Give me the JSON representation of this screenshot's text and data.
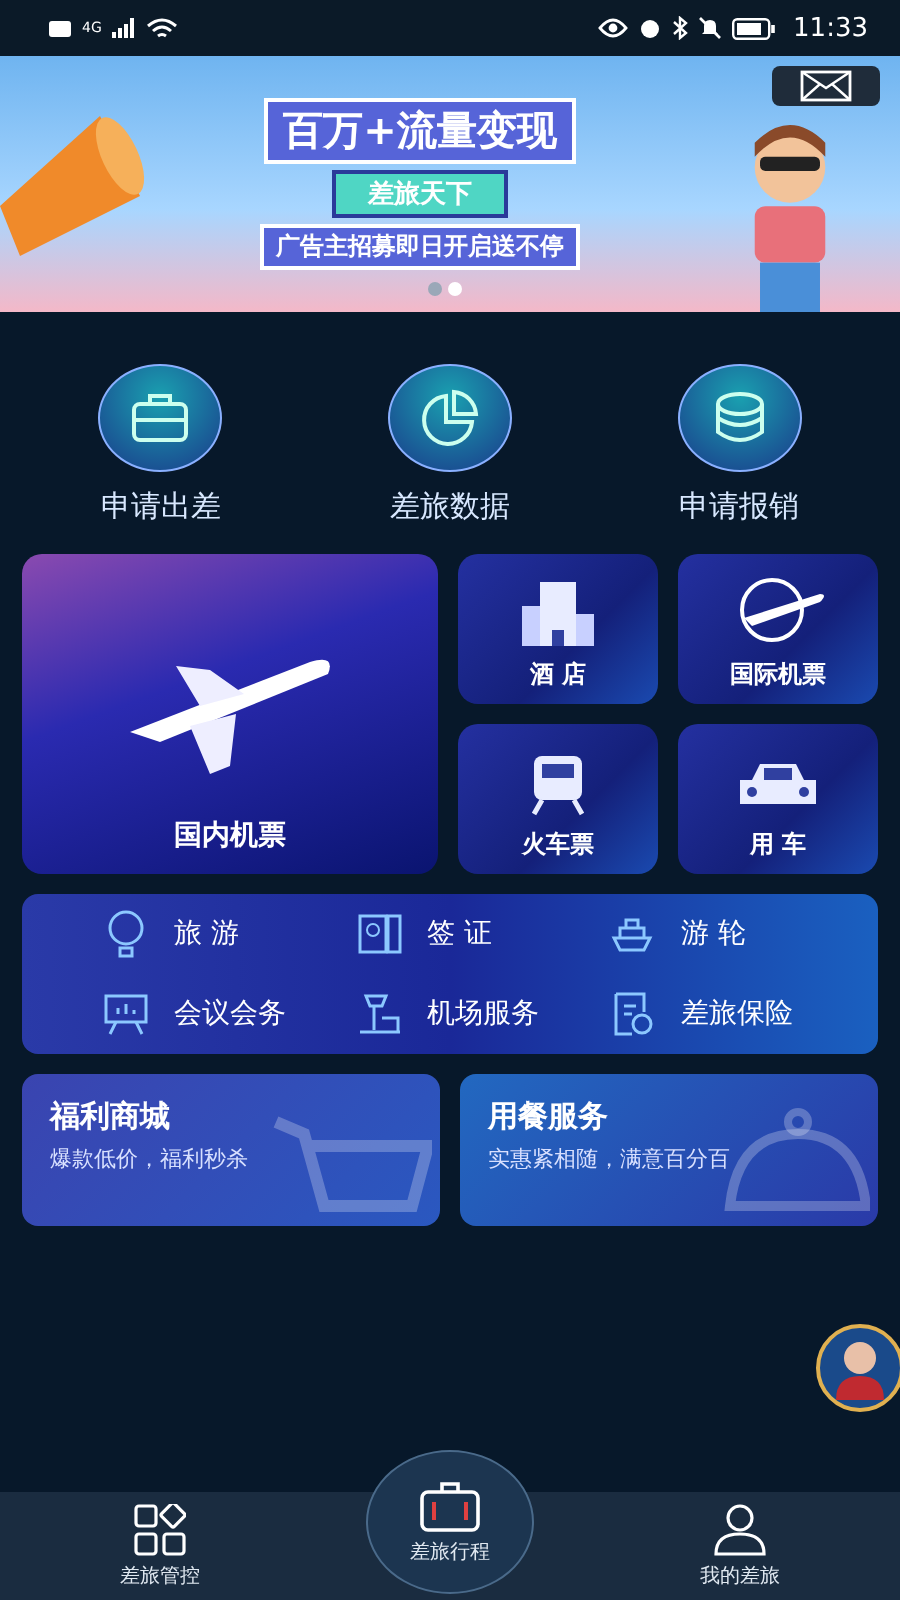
{
  "status_bar": {
    "network": "4G",
    "time": "11:33"
  },
  "banner": {
    "headline": "百万+流量变现",
    "tag": "差旅天下",
    "subline": "广告主招募即日开启送不停",
    "dots": [
      {
        "selected": false
      },
      {
        "selected": true
      }
    ]
  },
  "quick_actions": [
    {
      "label": "申请出差",
      "kind": "briefcase"
    },
    {
      "label": "差旅数据",
      "kind": "pie"
    },
    {
      "label": "申请报销",
      "kind": "coins"
    }
  ],
  "main_tile": {
    "label": "国内机票"
  },
  "small_tiles": [
    {
      "label": "酒 店",
      "kind": "hotel"
    },
    {
      "label": "国际机票",
      "kind": "globe"
    },
    {
      "label": "火车票",
      "kind": "train"
    },
    {
      "label": "用 车",
      "kind": "car"
    }
  ],
  "services": [
    {
      "label": "旅 游",
      "kind": "balloon"
    },
    {
      "label": "签 证",
      "kind": "passport"
    },
    {
      "label": "游 轮",
      "kind": "ship"
    },
    {
      "label": "会议会务",
      "kind": "board"
    },
    {
      "label": "机场服务",
      "kind": "tower"
    },
    {
      "label": "差旅保险",
      "kind": "doc"
    }
  ],
  "promos": [
    {
      "title": "福利商城",
      "subtitle": "爆款低价，福利秒杀",
      "kind": "cart"
    },
    {
      "title": "用餐服务",
      "subtitle": "实惠紧相随，满意百分百",
      "kind": "cloche"
    }
  ],
  "bottom_nav": [
    {
      "label": "差旅管控",
      "kind": "grid"
    },
    {
      "label": "差旅行程",
      "kind": "suitcase"
    },
    {
      "label": "我的差旅",
      "kind": "person"
    }
  ]
}
